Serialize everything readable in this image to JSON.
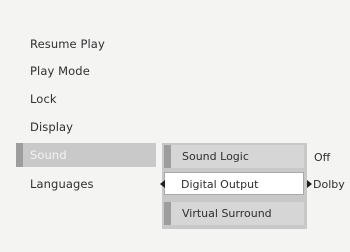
{
  "main_menu": {
    "items": [
      {
        "label": "Resume Play"
      },
      {
        "label": "Play Mode"
      },
      {
        "label": "Lock"
      },
      {
        "label": "Display"
      },
      {
        "label": "Sound"
      },
      {
        "label": "Languages"
      }
    ],
    "selected_label": "Sound"
  },
  "sound_submenu": {
    "items": [
      {
        "label": "Sound Logic",
        "value": "Off"
      },
      {
        "label": "Digital Output",
        "value": "Dolby"
      },
      {
        "label": "Virtual Surround"
      }
    ]
  },
  "icons": {
    "left": "triangle-left-icon",
    "right": "triangle-right-icon"
  },
  "colors": {
    "background": "#f4f4f3",
    "selected_bg": "#c9c9c9",
    "submenu_bg": "#d6d6d6",
    "highlight_bg": "#ffffff",
    "bar": "#9d9d9d"
  }
}
